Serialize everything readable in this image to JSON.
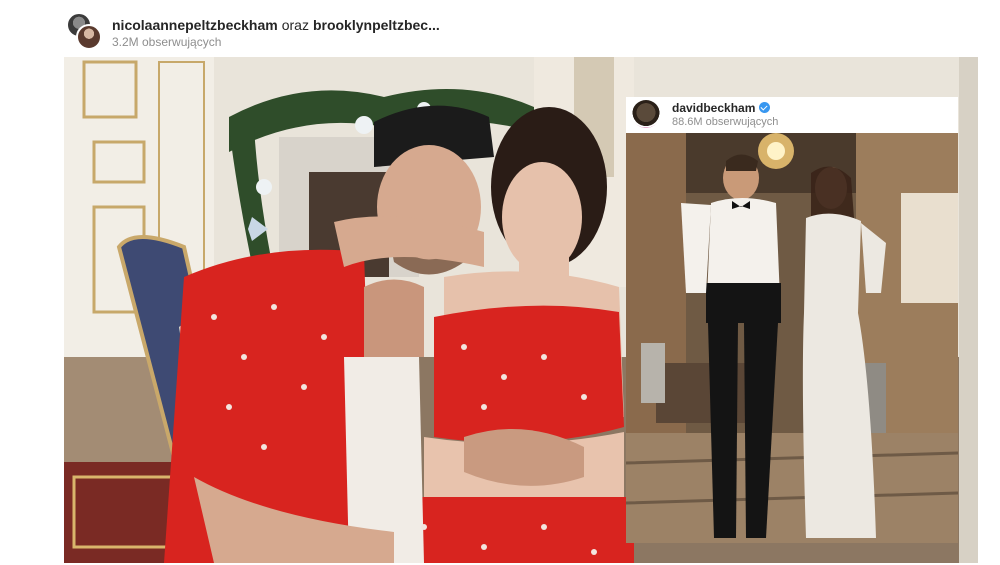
{
  "post": {
    "author1": "nicolaannepeltzbeckham",
    "conjunction": "oraz",
    "author2": "brooklynpeltzbec...",
    "followers": "3.2M obserwujących"
  },
  "inset_post": {
    "author": "davidbeckham",
    "followers": "88.6M obserwujących",
    "verified": true
  },
  "icons": {
    "avatars": [
      "avatar-nicola-icon",
      "avatar-brooklyn-icon"
    ],
    "verified_badge": "verified-badge-icon"
  },
  "colors": {
    "verified_blue": "#3897f0",
    "pajama_red": "#d8241f",
    "text_primary": "#262626",
    "text_secondary": "#8e8e8e"
  }
}
